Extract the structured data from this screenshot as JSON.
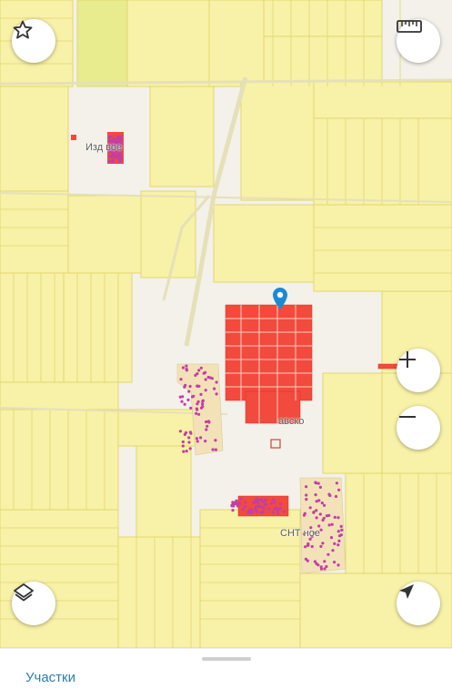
{
  "map": {
    "labels": {
      "village_top": "Изд  вое",
      "village_center": "авско",
      "snt": "СНТ          ное"
    },
    "colors": {
      "parcel_fill": "#f8f1a8",
      "parcel_stroke": "#e2d66e",
      "background": "#f3f1e9",
      "urban_red": "#f24a3d",
      "dot_purple": "#c23fa3",
      "pin": "#1a8ad6"
    }
  },
  "controls": {
    "favorite_icon": "star-icon",
    "ruler_icon": "ruler-icon",
    "zoom_in_icon": "plus-icon",
    "zoom_out_icon": "minus-icon",
    "layers_icon": "layers-icon",
    "locate_icon": "navigation-arrow-icon"
  },
  "sheet": {
    "title": "Участки"
  }
}
